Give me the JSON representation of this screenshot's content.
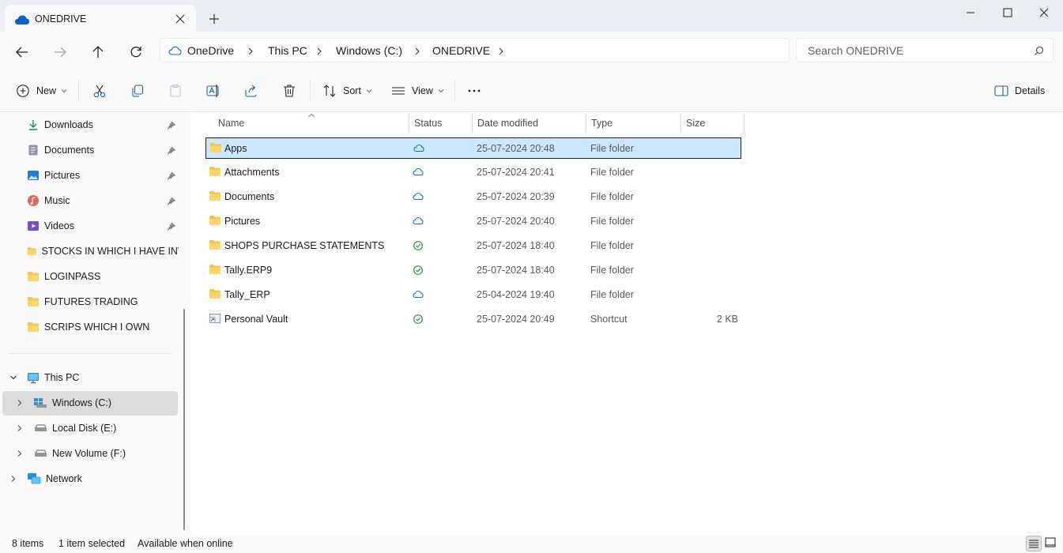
{
  "window": {
    "tab_title": "ONEDRIVE",
    "colors": {
      "accent": "#0067c0",
      "selection": "#cce8ff",
      "folder": "#f7c348",
      "synced_green": "#2f8f3a",
      "cloud_blue": "#1a73c8"
    }
  },
  "address": {
    "crumbs": [
      "OneDrive",
      "This PC",
      "Windows (C:)",
      "ONEDRIVE"
    ],
    "search_placeholder": "Search ONEDRIVE"
  },
  "toolbar": {
    "new_label": "New",
    "sort_label": "Sort",
    "view_label": "View",
    "details_label": "Details",
    "icons": [
      "cut-icon",
      "copy-icon",
      "paste-icon",
      "rename-icon",
      "share-icon",
      "delete-icon",
      "more-icon"
    ]
  },
  "sidebar": {
    "quick_access": [
      {
        "label": "Downloads",
        "icon": "download-icon",
        "pinned": true
      },
      {
        "label": "Documents",
        "icon": "document-icon",
        "pinned": true
      },
      {
        "label": "Pictures",
        "icon": "picture-icon",
        "pinned": true
      },
      {
        "label": "Music",
        "icon": "music-icon",
        "pinned": true
      },
      {
        "label": "Videos",
        "icon": "video-icon",
        "pinned": true
      },
      {
        "label": "STOCKS IN WHICH I HAVE INVESTED",
        "icon": "folder-icon",
        "pinned": false
      },
      {
        "label": "LOGINPASS",
        "icon": "folder-icon",
        "pinned": false
      },
      {
        "label": "FUTURES TRADING",
        "icon": "folder-icon",
        "pinned": false
      },
      {
        "label": "SCRIPS WHICH I OWN",
        "icon": "folder-icon",
        "pinned": false
      }
    ],
    "this_pc": "This PC",
    "drives": [
      "Windows (C:)",
      "Local Disk (E:)",
      "New Volume (F:)"
    ],
    "network": "Network"
  },
  "columns": {
    "name": "Name",
    "status": "Status",
    "date": "Date modified",
    "type": "Type",
    "size": "Size"
  },
  "files": [
    {
      "name": "Apps",
      "status": "cloud",
      "date": "25-07-2024 20:48",
      "type": "File folder",
      "size": ""
    },
    {
      "name": "Attachments",
      "status": "cloud",
      "date": "25-07-2024 20:41",
      "type": "File folder",
      "size": ""
    },
    {
      "name": "Documents",
      "status": "cloud",
      "date": "25-07-2024 20:39",
      "type": "File folder",
      "size": ""
    },
    {
      "name": "Pictures",
      "status": "cloud",
      "date": "25-07-2024 20:40",
      "type": "File folder",
      "size": ""
    },
    {
      "name": "SHOPS PURCHASE STATEMENTS",
      "status": "synced",
      "date": "25-07-2024 18:40",
      "type": "File folder",
      "size": ""
    },
    {
      "name": "Tally.ERP9",
      "status": "synced",
      "date": "25-07-2024 18:40",
      "type": "File folder",
      "size": ""
    },
    {
      "name": "Tally_ERP",
      "status": "cloud",
      "date": "25-04-2024 19:40",
      "type": "File folder",
      "size": ""
    },
    {
      "name": "Personal Vault",
      "status": "synced",
      "date": "25-07-2024 20:49",
      "type": "Shortcut",
      "size": "2 KB"
    }
  ],
  "selected_index": 0,
  "statusbar": {
    "item_count": "8 items",
    "selection": "1 item selected",
    "availability": "Available when online"
  }
}
